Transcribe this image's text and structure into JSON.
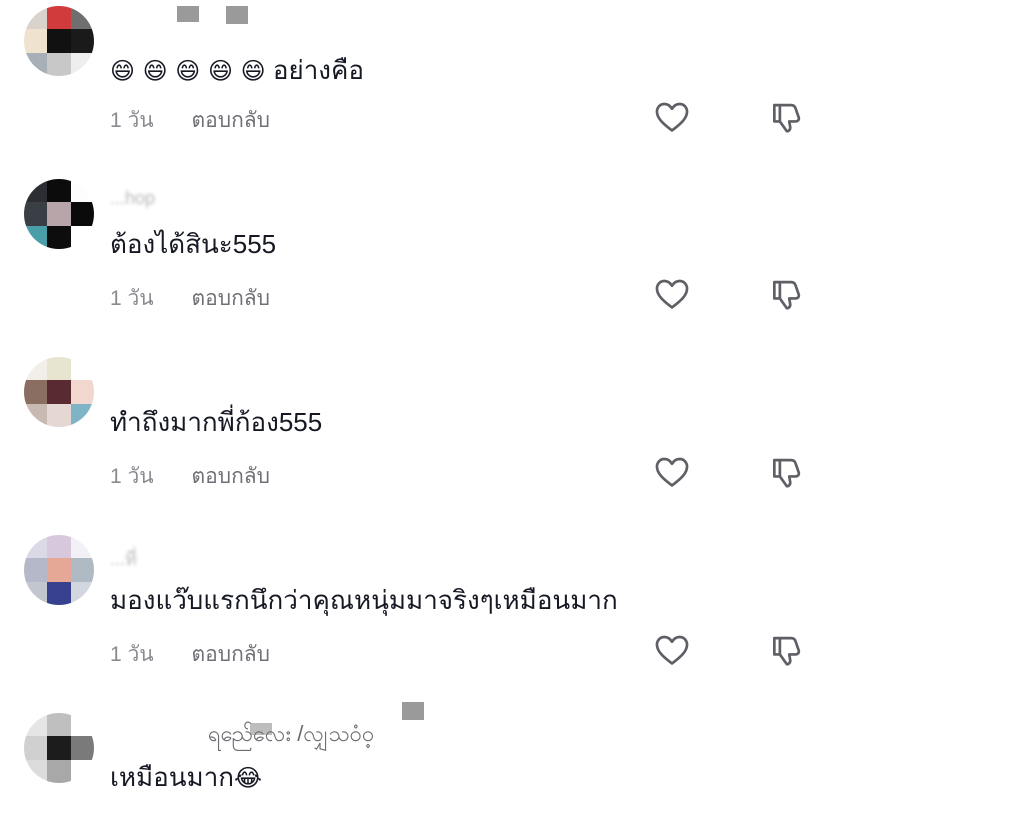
{
  "comments": [
    {
      "username": "",
      "text": "อย่างคือ",
      "emoji_prefix": "😄 😄 😄 😄 😄",
      "time": "1 วัน",
      "reply_label": "ตอบกลับ"
    },
    {
      "username": "...hop",
      "text": "ต้องได้สินะ555",
      "time": "1 วัน",
      "reply_label": "ตอบกลับ"
    },
    {
      "username": "",
      "text": "ทำถึงมากพี่ก้อง555",
      "time": "1 วัน",
      "reply_label": "ตอบกลับ"
    },
    {
      "username": "...ที่",
      "text": "มองแว๊บแรกนึกว่าคุณหนุ่มมาจริงๆเหมือนมาก",
      "time": "1 วัน",
      "reply_label": "ตอบกลับ"
    },
    {
      "username": "ရည်ေလေး /လျှသဝံဝ့",
      "text": "เหมือนมาก",
      "emoji_suffix": "😂"
    }
  ],
  "icons": {
    "like": "heart-outline-icon",
    "dislike": "thumbs-down-outline-icon"
  },
  "colors": {
    "text": "#161823",
    "meta": "#8a8b91",
    "icon": "#5f5f66",
    "background": "#ffffff"
  }
}
